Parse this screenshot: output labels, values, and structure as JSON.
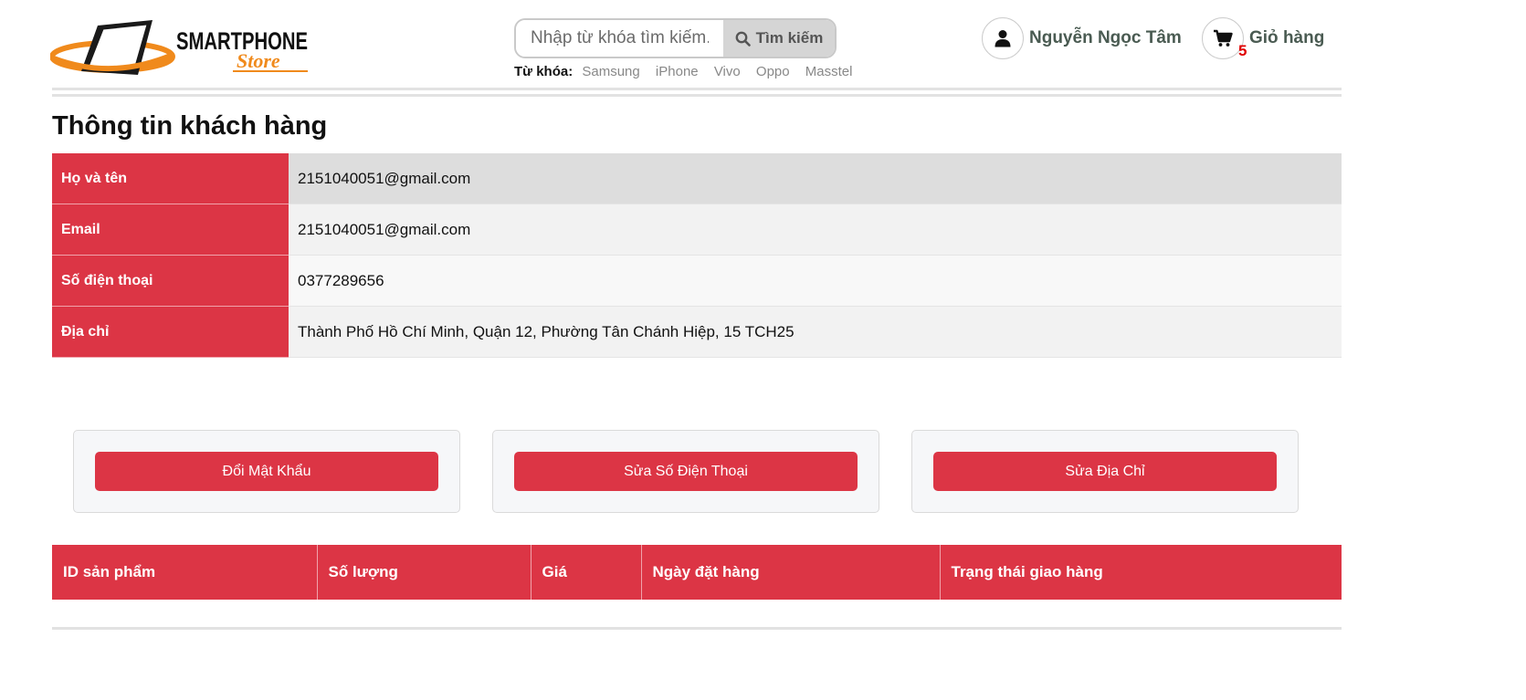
{
  "header": {
    "logo": {
      "word1": "SMARTPHONE",
      "word2": "Store"
    },
    "search": {
      "placeholder": "Nhập từ khóa tìm kiếm...",
      "button_label": "Tìm kiếm"
    },
    "keywords_label": "Từ khóa:",
    "keywords": [
      "Samsung",
      "iPhone",
      "Vivo",
      "Oppo",
      "Masstel"
    ],
    "user_name": "Nguyễn Ngọc Tâm",
    "cart_label": "Giỏ hàng",
    "cart_count": "5"
  },
  "page_title": "Thông tin khách hàng",
  "customer_info": [
    {
      "label": "Họ và tên",
      "value": "2151040051@gmail.com"
    },
    {
      "label": "Email",
      "value": "2151040051@gmail.com"
    },
    {
      "label": "Số điện thoại",
      "value": "0377289656"
    },
    {
      "label": "Địa chỉ",
      "value": "Thành Phố Hồ Chí Minh, Quận 12, Phường Tân Chánh Hiệp, 15 TCH25"
    }
  ],
  "actions": {
    "change_password": "Đổi Mật Khẩu",
    "edit_phone": "Sửa Số Điện Thoại",
    "edit_address": "Sửa Địa Chỉ"
  },
  "orders_table": {
    "columns": [
      "ID sản phẩm",
      "Số lượng",
      "Giá",
      "Ngày đặt hàng",
      "Trạng thái giao hàng"
    ]
  },
  "colors": {
    "accent": "#dc3545",
    "cart_count": "#e00000"
  }
}
